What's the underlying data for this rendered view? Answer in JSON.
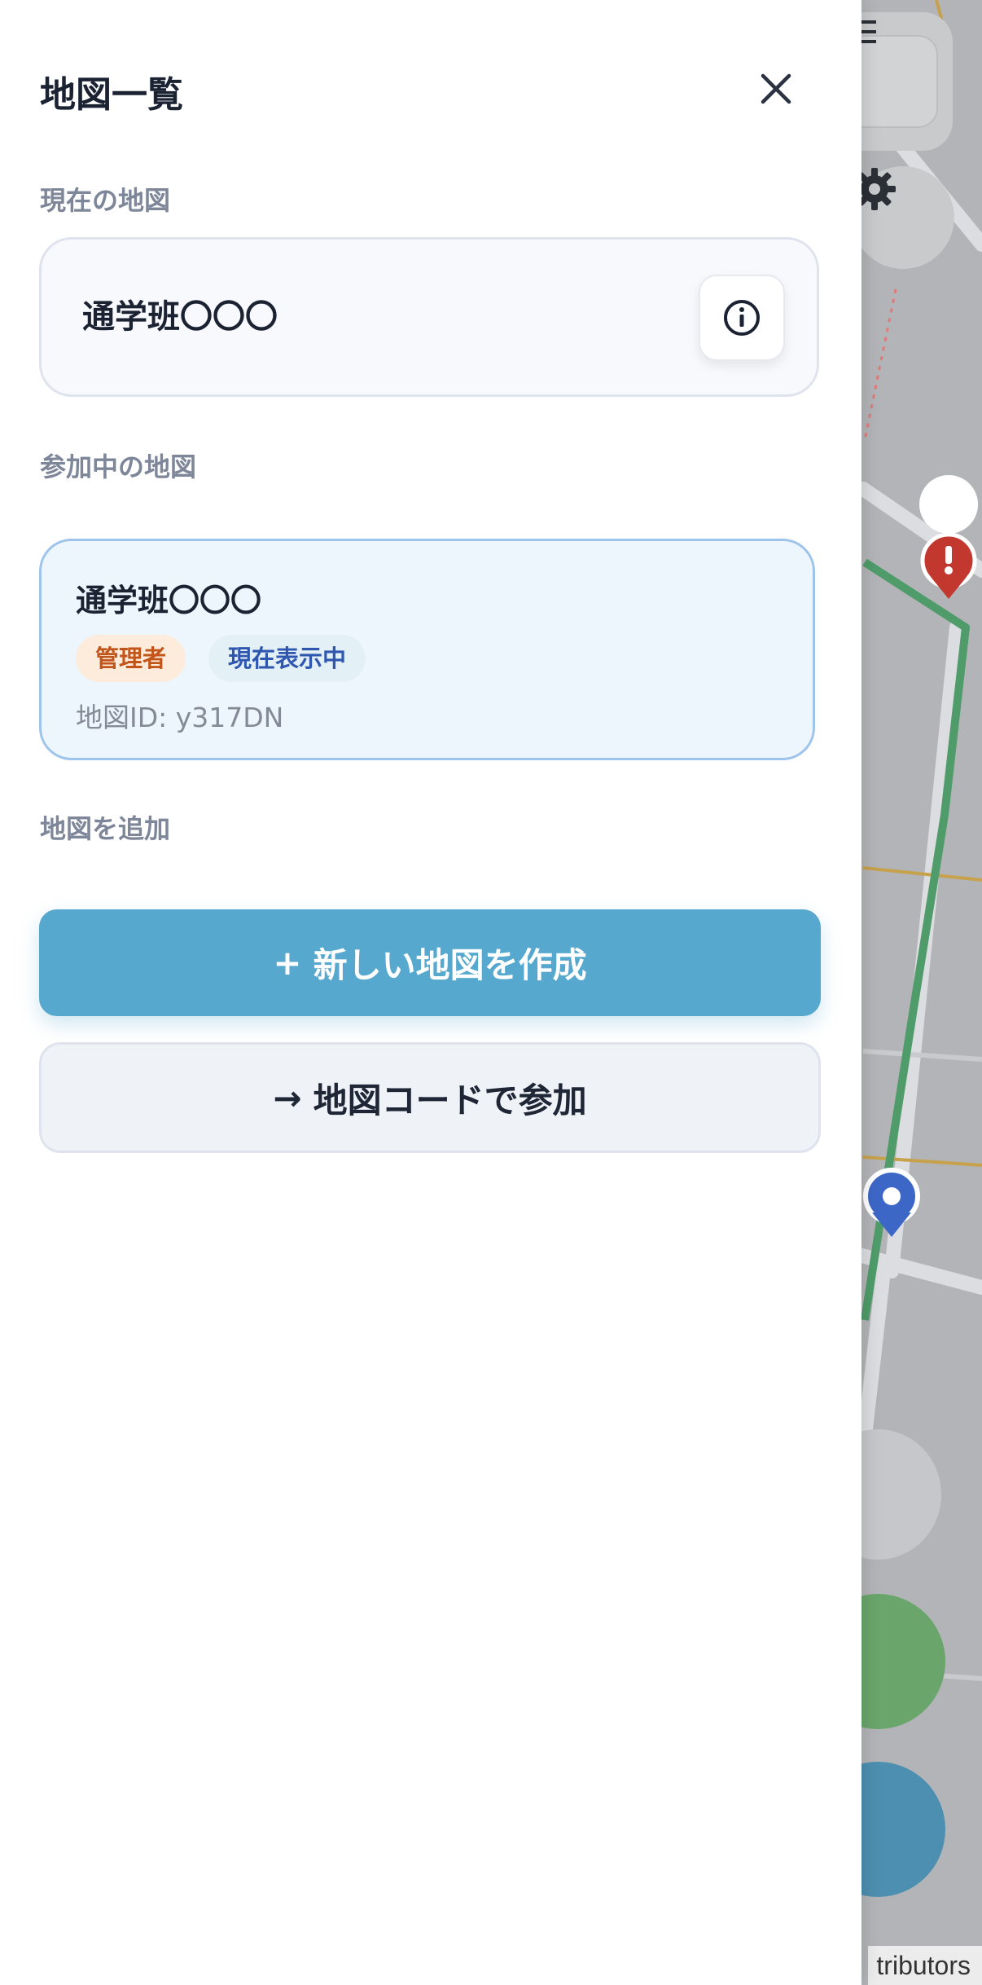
{
  "drawer": {
    "title": "地図一覧",
    "close_icon": "close-icon",
    "sections": {
      "current": "現在の地図",
      "joined": "参加中の地図",
      "add": "地図を追加"
    },
    "current_map": {
      "name": "通学班〇〇〇",
      "info_icon": "info-icon"
    },
    "joined_maps": [
      {
        "name": "通学班〇〇〇",
        "badges": [
          "管理者",
          "現在表示中"
        ],
        "map_id": "地図ID: y317DN"
      }
    ],
    "create_button": {
      "icon": "+",
      "label": "新しい地図を作成"
    },
    "join_button": {
      "icon": "→",
      "label": "地図コードで参加"
    }
  },
  "map": {
    "attribution": "tributors",
    "controls": [
      "legend-icon",
      "gear-icon",
      "locate-icon",
      "route-icon",
      "location-pin-icon"
    ]
  },
  "colors": {
    "accent": "#56a8cf",
    "route": "#4f9c6a",
    "alert_pin": "#c2382f",
    "user_pin": "#3d67c7",
    "admin_badge_text": "#c2561a",
    "current_badge_text": "#2f57b0"
  }
}
